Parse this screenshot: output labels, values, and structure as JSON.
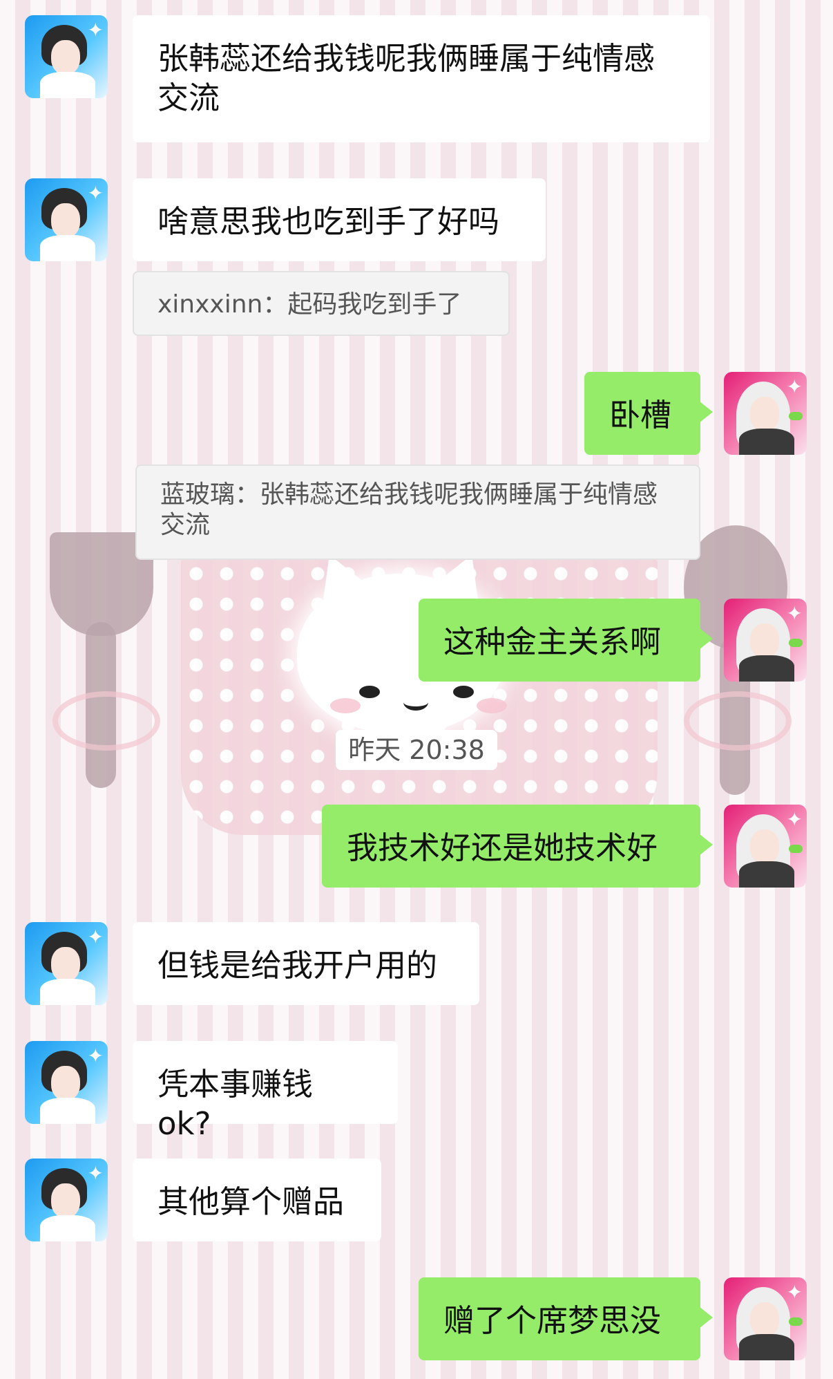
{
  "messages": [
    {
      "sender": "other",
      "text": "张韩蕊还给我钱呢我俩睡属于纯情感交流"
    },
    {
      "sender": "other",
      "text": "啥意思我也吃到手了好吗"
    },
    {
      "sender": "quote",
      "text": "xinxxinn：起码我吃到手了"
    },
    {
      "sender": "me",
      "text": "卧槽"
    },
    {
      "sender": "quote",
      "text": "蓝玻璃：张韩蕊还给我钱呢我俩睡属于纯情感交流"
    },
    {
      "sender": "me",
      "text": "这种金主关系啊"
    },
    {
      "sender": "time",
      "text": "昨天 20:38"
    },
    {
      "sender": "me",
      "text": "我技术好还是她技术好"
    },
    {
      "sender": "other",
      "text": "但钱是给我开户用的"
    },
    {
      "sender": "other",
      "text": "凭本事赚钱 ok?"
    },
    {
      "sender": "other",
      "text": "其他算个赠品"
    },
    {
      "sender": "me",
      "text": "赠了个席梦思没"
    }
  ],
  "icons": {
    "other_avatar": "anime-avatar-dark-hair-icon",
    "my_avatar": "anime-avatar-white-hair-icon",
    "sparkle": "sparkle-icon"
  },
  "colors": {
    "my_bubble": "#95ec69",
    "other_bubble": "#ffffff",
    "quote_bg": "#f3f3f3"
  }
}
